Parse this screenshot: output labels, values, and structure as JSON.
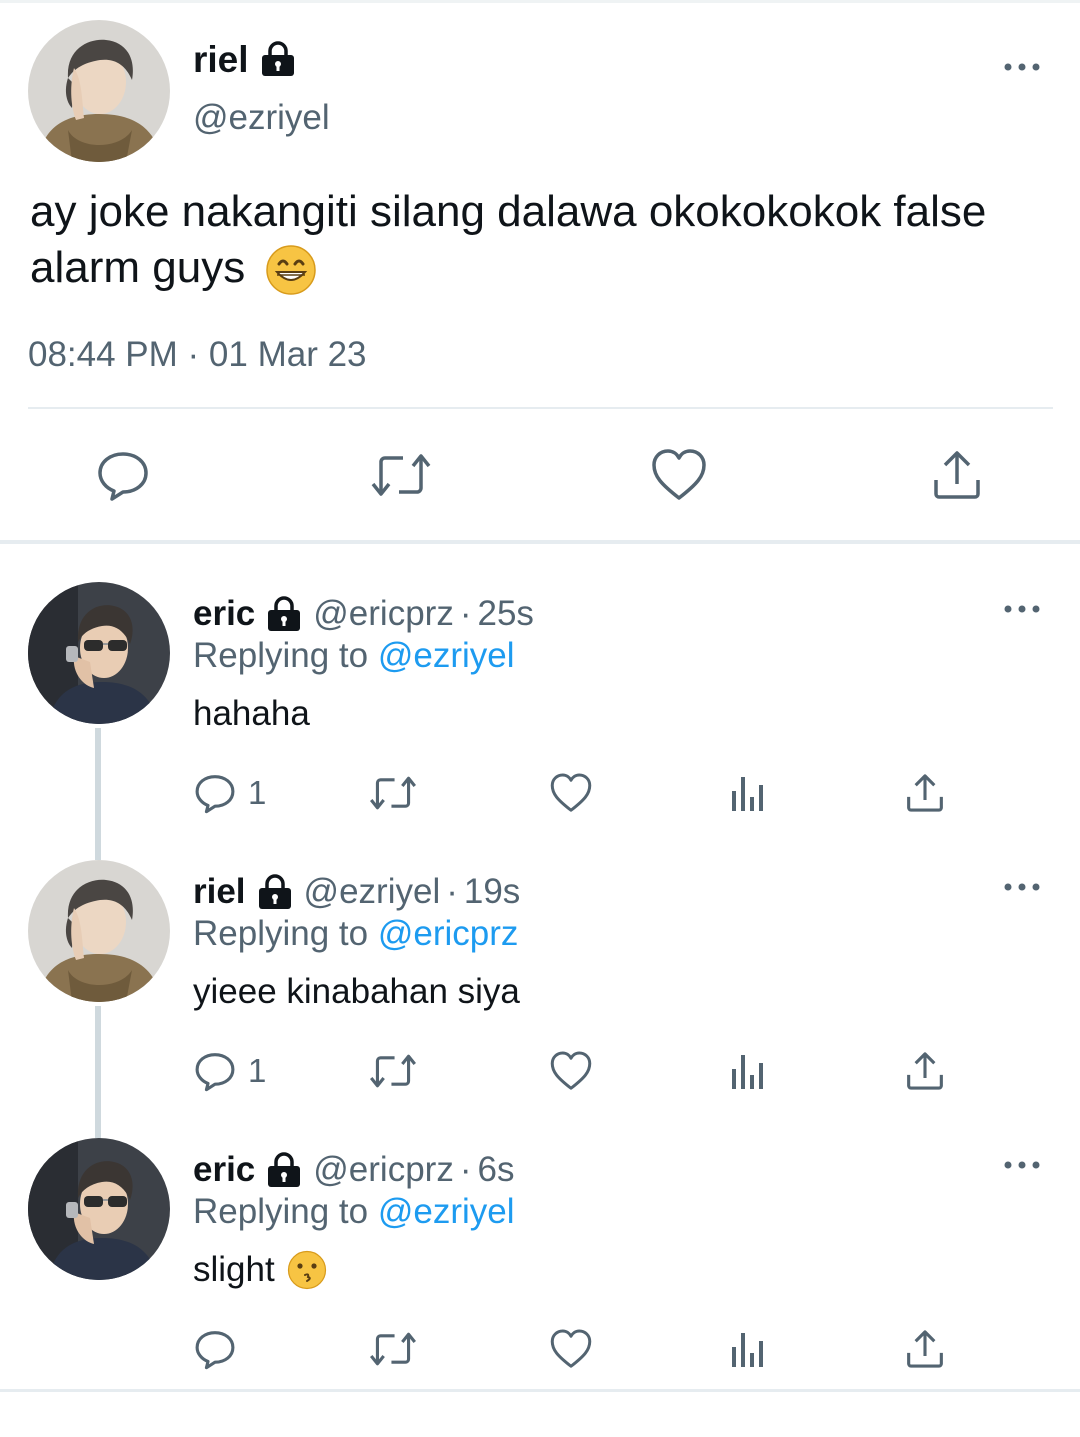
{
  "main_tweet": {
    "author_name": "riel",
    "author_handle": "@ezriyel",
    "text": "ay joke nakangiti silang dalawa okokokokok false alarm guys",
    "emoji": "😁",
    "timestamp": "08:44 PM · 01 Mar 23",
    "actions": [
      {
        "name": "reply",
        "icon": "comment-icon"
      },
      {
        "name": "retweet",
        "icon": "retweet-icon"
      },
      {
        "name": "like",
        "icon": "heart-icon"
      },
      {
        "name": "share",
        "icon": "share-icon"
      }
    ]
  },
  "replies": [
    {
      "author_name": "eric",
      "author_handle": "@ericprz",
      "age": "25s",
      "replying_label": "Replying to",
      "replying_to": "@ezriyel",
      "text": "hahaha",
      "emoji": "",
      "reply_count": "1"
    },
    {
      "author_name": "riel",
      "author_handle": "@ezriyel",
      "age": "19s",
      "replying_label": "Replying to",
      "replying_to": "@ericprz",
      "text": "yieee kinabahan siya",
      "emoji": "",
      "reply_count": "1"
    },
    {
      "author_name": "eric",
      "author_handle": "@ericprz",
      "age": "6s",
      "replying_label": "Replying to",
      "replying_to": "@ezriyel",
      "text": "slight",
      "emoji": "😗",
      "reply_count": ""
    }
  ],
  "separator_dot": "·",
  "colors": {
    "text_primary": "#0f1419",
    "text_secondary": "#536471",
    "link": "#1d9bf0",
    "icon": "#536471",
    "divider": "#e6ecf0",
    "thread_line": "#cfd9de"
  }
}
